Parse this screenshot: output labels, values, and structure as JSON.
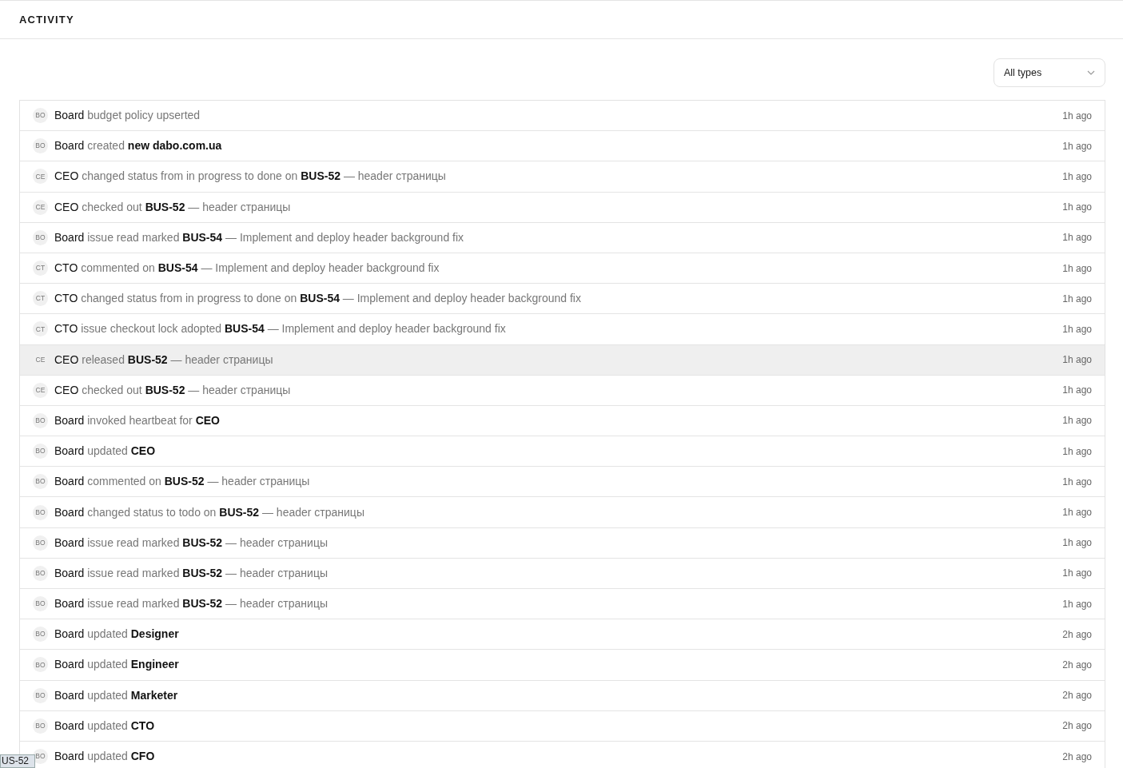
{
  "header": {
    "title": "ACTIVITY"
  },
  "filter": {
    "value": "All types"
  },
  "rows": [
    {
      "avatar": "BO",
      "actor": "Board",
      "action": "budget policy upserted",
      "time": "1h ago",
      "highlighted": false
    },
    {
      "avatar": "BO",
      "actor": "Board",
      "action": "created",
      "target": "new dabo.com.ua",
      "time": "1h ago",
      "highlighted": false
    },
    {
      "avatar": "CE",
      "actor": "CEO",
      "action": "changed status from in progress to done on",
      "target": "BUS-52",
      "detail": "— header страницы",
      "time": "1h ago",
      "highlighted": false
    },
    {
      "avatar": "CE",
      "actor": "CEO",
      "action": "checked out",
      "target": "BUS-52",
      "detail": "— header страницы",
      "time": "1h ago",
      "highlighted": false
    },
    {
      "avatar": "BO",
      "actor": "Board",
      "action": "issue read marked",
      "target": "BUS-54",
      "detail": "— Implement and deploy header background fix",
      "time": "1h ago",
      "highlighted": false
    },
    {
      "avatar": "CT",
      "actor": "CTO",
      "action": "commented on",
      "target": "BUS-54",
      "detail": "— Implement and deploy header background fix",
      "time": "1h ago",
      "highlighted": false
    },
    {
      "avatar": "CT",
      "actor": "CTO",
      "action": "changed status from in progress to done on",
      "target": "BUS-54",
      "detail": "— Implement and deploy header background fix",
      "time": "1h ago",
      "highlighted": false
    },
    {
      "avatar": "CT",
      "actor": "CTO",
      "action": "issue checkout lock adopted",
      "target": "BUS-54",
      "detail": "— Implement and deploy header background fix",
      "time": "1h ago",
      "highlighted": false
    },
    {
      "avatar": "CE",
      "actor": "CEO",
      "action": "released",
      "target": "BUS-52",
      "detail": "— header страницы",
      "time": "1h ago",
      "highlighted": true
    },
    {
      "avatar": "CE",
      "actor": "CEO",
      "action": "checked out",
      "target": "BUS-52",
      "detail": "— header страницы",
      "time": "1h ago",
      "highlighted": false
    },
    {
      "avatar": "BO",
      "actor": "Board",
      "action": "invoked heartbeat for",
      "target": "CEO",
      "time": "1h ago",
      "highlighted": false
    },
    {
      "avatar": "BO",
      "actor": "Board",
      "action": "updated",
      "target": "CEO",
      "time": "1h ago",
      "highlighted": false
    },
    {
      "avatar": "BO",
      "actor": "Board",
      "action": "commented on",
      "target": "BUS-52",
      "detail": "— header страницы",
      "time": "1h ago",
      "highlighted": false
    },
    {
      "avatar": "BO",
      "actor": "Board",
      "action": "changed status to todo on",
      "target": "BUS-52",
      "detail": "— header страницы",
      "time": "1h ago",
      "highlighted": false
    },
    {
      "avatar": "BO",
      "actor": "Board",
      "action": "issue read marked",
      "target": "BUS-52",
      "detail": "— header страницы",
      "time": "1h ago",
      "highlighted": false
    },
    {
      "avatar": "BO",
      "actor": "Board",
      "action": "issue read marked",
      "target": "BUS-52",
      "detail": "— header страницы",
      "time": "1h ago",
      "highlighted": false
    },
    {
      "avatar": "BO",
      "actor": "Board",
      "action": "issue read marked",
      "target": "BUS-52",
      "detail": "— header страницы",
      "time": "1h ago",
      "highlighted": false
    },
    {
      "avatar": "BO",
      "actor": "Board",
      "action": "updated",
      "target": "Designer",
      "time": "2h ago",
      "highlighted": false
    },
    {
      "avatar": "BO",
      "actor": "Board",
      "action": "updated",
      "target": "Engineer",
      "time": "2h ago",
      "highlighted": false
    },
    {
      "avatar": "BO",
      "actor": "Board",
      "action": "updated",
      "target": "Marketer",
      "time": "2h ago",
      "highlighted": false
    },
    {
      "avatar": "BO",
      "actor": "Board",
      "action": "updated",
      "target": "CTO",
      "time": "2h ago",
      "highlighted": false
    },
    {
      "avatar": "BO",
      "actor": "Board",
      "action": "updated",
      "target": "CFO",
      "time": "2h ago",
      "highlighted": false
    }
  ],
  "tooltip": {
    "text": "US-52"
  }
}
